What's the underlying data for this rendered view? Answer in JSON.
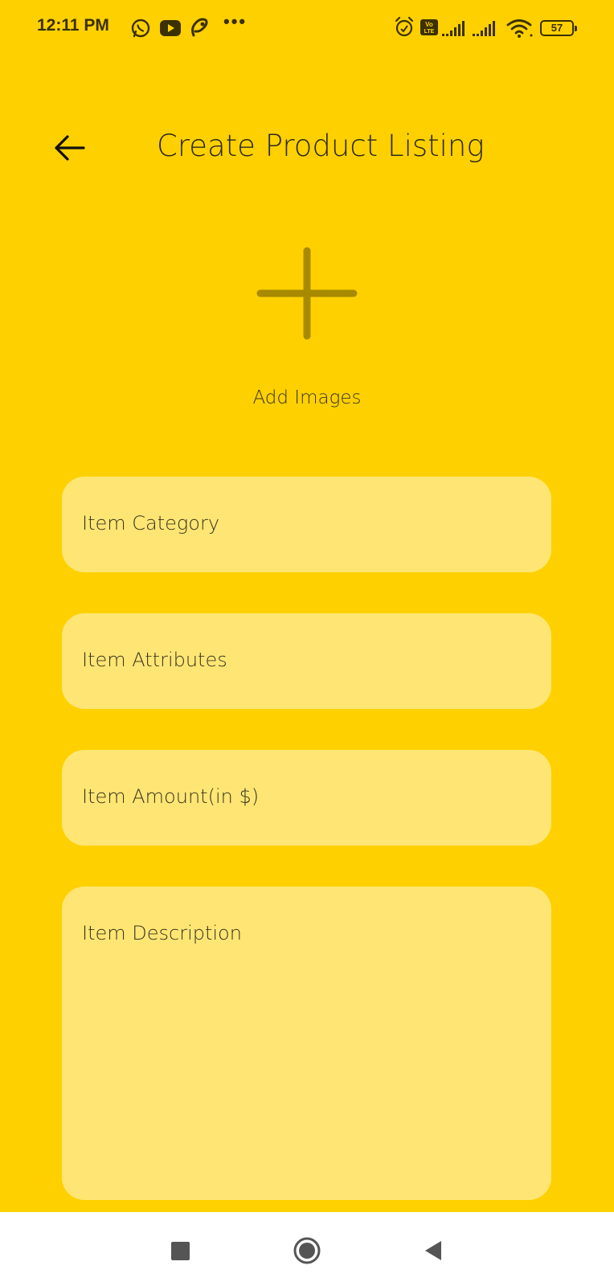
{
  "status_bar": {
    "time": "12:11 PM",
    "left_icons": [
      "whatsapp-icon",
      "youtube-icon",
      "app-icon"
    ],
    "overflow": "•••",
    "right_icons": [
      "alarm-icon",
      "volte-icon",
      "signal-icon",
      "signal-icon",
      "wifi-icon"
    ],
    "battery": "57"
  },
  "header": {
    "back_icon": "arrow-left-icon",
    "title": "Create Product Listing"
  },
  "add_images": {
    "icon": "plus-icon",
    "label": "Add Images"
  },
  "form": {
    "category_placeholder": "Item Category",
    "attributes_placeholder": "Item Attributes",
    "amount_placeholder": "Item Amount(in $)",
    "description_placeholder": "Item Description"
  },
  "nav": {
    "recents_icon": "square-icon",
    "home_icon": "circle-icon",
    "back_icon": "triangle-back-icon"
  },
  "colors": {
    "background": "#FFD000",
    "field_background": "#FFE674",
    "plus_icon": "#A88A00",
    "nav_background": "#FFFFFF"
  }
}
